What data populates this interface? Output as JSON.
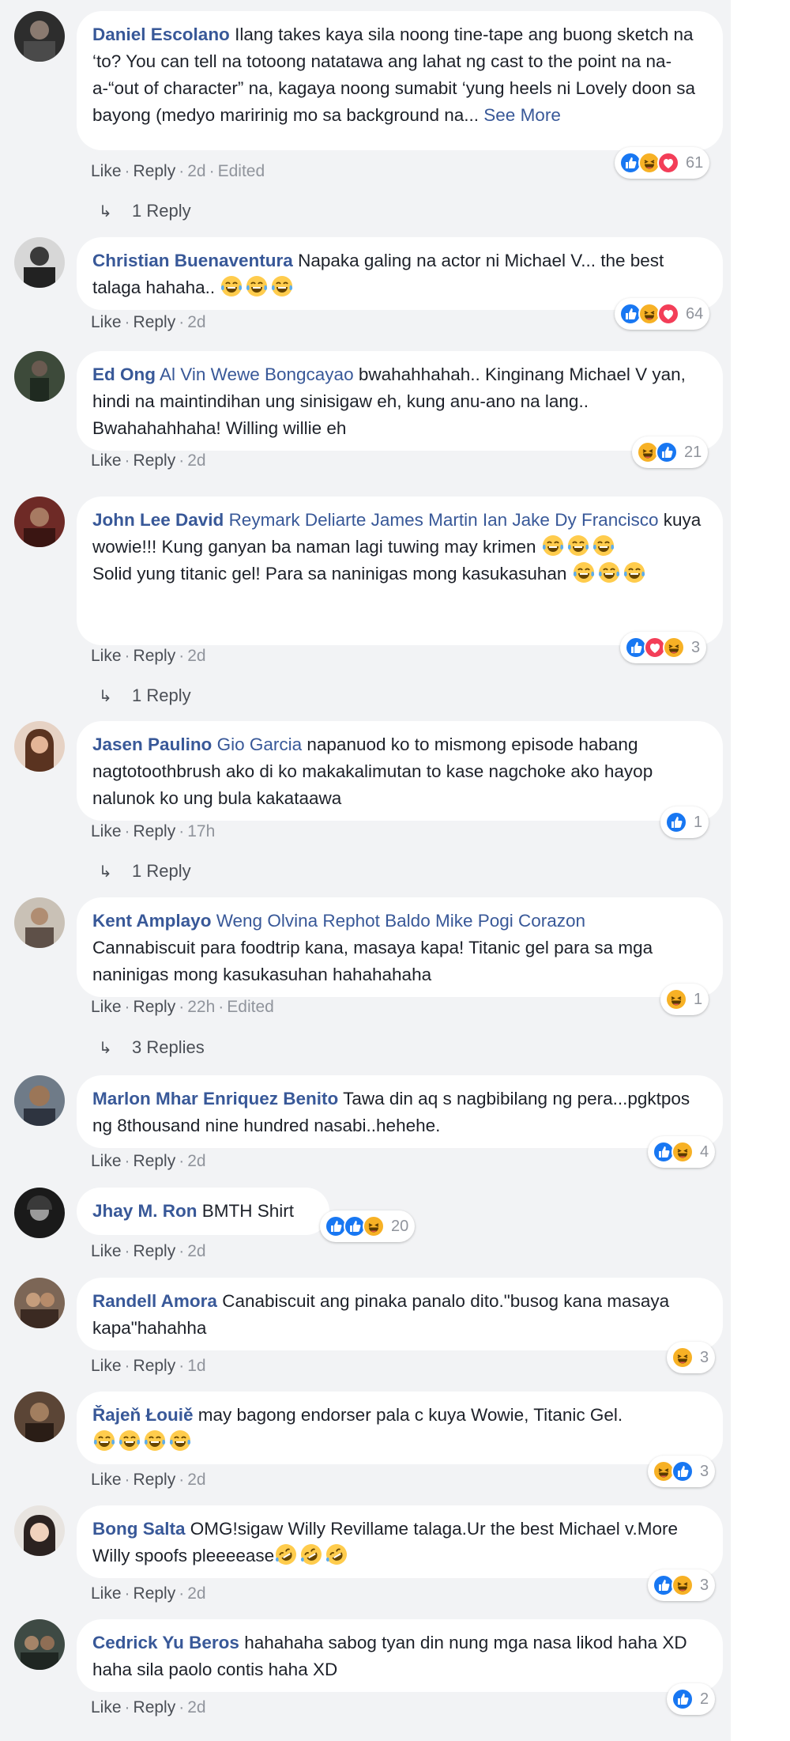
{
  "comments": [
    {
      "author": "Daniel Escolano",
      "tags": "",
      "text": "Ilang takes kaya sila noong tine-tape ang buong sketch na ‘to? You can tell na totoong natatawa ang lahat ng cast to the point na na-a-“out of character” na, kagaya noong sumabit ‘yung heels ni Lovely doon sa bayong (medyo maririnig mo sa background na...",
      "see_more": "See More",
      "like": "Like",
      "reply": "Reply",
      "time": "2d",
      "edited": "Edited",
      "reactions": [
        "like",
        "haha",
        "love"
      ],
      "count": "61",
      "replies": "1 Reply"
    },
    {
      "author": "Christian Buenaventura",
      "text": "Napaka galing na actor ni Michael V... the best talaga hahaha..",
      "emoji_trail": 3,
      "like": "Like",
      "reply": "Reply",
      "time": "2d",
      "reactions": [
        "like",
        "haha",
        "love"
      ],
      "count": "64"
    },
    {
      "author": "Ed Ong",
      "tags": "Al Vin Wewe Bongcayao",
      "text": "bwahahhahah.. Kinginang Michael V yan, hindi na maintindihan ung sinisigaw eh, kung anu-ano na lang.. Bwahahahhaha! Willing willie eh",
      "like": "Like",
      "reply": "Reply",
      "time": "2d",
      "reactions": [
        "haha",
        "like"
      ],
      "count": "21"
    },
    {
      "author": "John Lee David",
      "tags": "Reymark Deliarte James Martin Ian Jake Dy Francisco",
      "text": "kuya wowie!!! Kung ganyan ba naman lagi tuwing may krimen",
      "text2": "Solid yung titanic gel! Para sa naninigas mong kasukasuhan",
      "like": "Like",
      "reply": "Reply",
      "time": "2d",
      "reactions": [
        "like",
        "love",
        "haha"
      ],
      "count": "3",
      "replies": "1 Reply"
    },
    {
      "author": "Jasen Paulino",
      "tags": "Gio Garcia",
      "text": "napanuod ko to mismong episode habang nagtotoothbrush ako di ko makakalimutan to kase nagchoke ako hayop nalunok ko ung bula kakataawa",
      "like": "Like",
      "reply": "Reply",
      "time": "17h",
      "reactions": [
        "like"
      ],
      "count": "1",
      "replies": "1 Reply"
    },
    {
      "author": "Kent Amplayo",
      "tags": "Weng Olvina Rephot Baldo Mike Pogi Corazon",
      "text": "Cannabiscuit para foodtrip kana, masaya kapa! Titanic gel para sa mga naninigas mong kasukasuhan hahahahaha",
      "like": "Like",
      "reply": "Reply",
      "time": "22h",
      "edited": "Edited",
      "reactions": [
        "haha"
      ],
      "count": "1",
      "replies": "3 Replies"
    },
    {
      "author": "Marlon Mhar Enriquez Benito",
      "text": "Tawa din aq s nagbibilang ng pera...pgktpos ng 8thousand nine hundred nasabi..hehehe.",
      "like": "Like",
      "reply": "Reply",
      "time": "2d",
      "reactions": [
        "like",
        "haha"
      ],
      "count": "4"
    },
    {
      "author": "Jhay M. Ron",
      "text": "BMTH Shirt",
      "like": "Like",
      "reply": "Reply",
      "time": "2d",
      "reactions": [
        "like",
        "like",
        "haha"
      ],
      "count": "20"
    },
    {
      "author": "Randell Amora",
      "text": "Canabiscuit ang pinaka panalo dito.\"busog kana masaya kapa\"hahahha",
      "like": "Like",
      "reply": "Reply",
      "time": "1d",
      "reactions": [
        "haha"
      ],
      "count": "3"
    },
    {
      "author": "Řajeň Łouiě",
      "text": "may bagong endorser pala c kuya Wowie, Titanic Gel.",
      "like": "Like",
      "reply": "Reply",
      "time": "2d",
      "reactions": [
        "haha",
        "like"
      ],
      "count": "3"
    },
    {
      "author": "Bong Salta",
      "text": "OMG!sigaw Willy Revillame talaga.Ur the best Michael v.More Willy spoofs pleeeease",
      "like": "Like",
      "reply": "Reply",
      "time": "2d",
      "reactions": [
        "like",
        "haha"
      ],
      "count": "3"
    },
    {
      "author": "Cedrick Yu Beros",
      "text": "hahahaha sabog tyan din nung mga nasa likod haha XD haha sila paolo contis haha XD",
      "like": "Like",
      "reply": "Reply",
      "time": "2d",
      "reactions": [
        "like"
      ],
      "count": "2"
    }
  ],
  "colors": {
    "link": "#385898",
    "meta": "#90949c",
    "like_blue": "#1877f2",
    "love_red": "#f33e58",
    "haha_yellow": "#f7b125"
  },
  "icons": {
    "like": "thumbs-up-icon",
    "love": "heart-icon",
    "haha": "laughing-face-icon",
    "reply_arrow": "reply-arrow-icon",
    "tears_of_joy": "tears-of-joy-emoji",
    "rofl": "rolling-laughing-emoji"
  }
}
